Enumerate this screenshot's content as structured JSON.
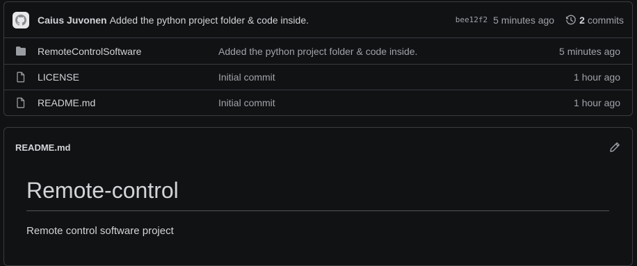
{
  "commit": {
    "author": "Caius Juvonen",
    "message": "Added the python project folder & code inside.",
    "sha": "bee12f2",
    "time": "5 minutes ago",
    "count": "2",
    "count_label": "commits"
  },
  "files": [
    {
      "name": "RemoteControlSoftware",
      "type": "folder",
      "message": "Added the python project folder & code inside.",
      "time": "5 minutes ago"
    },
    {
      "name": "LICENSE",
      "type": "file",
      "message": "Initial commit",
      "time": "1 hour ago"
    },
    {
      "name": "README.md",
      "type": "file",
      "message": "Initial commit",
      "time": "1 hour ago"
    }
  ],
  "readme": {
    "filename": "README.md",
    "heading": "Remote-control",
    "body": "Remote control software project"
  },
  "icons": {
    "avatar": "github-avatar-icon",
    "history": "history-icon",
    "folder": "folder-icon",
    "file": "file-icon",
    "edit": "pencil-icon"
  }
}
